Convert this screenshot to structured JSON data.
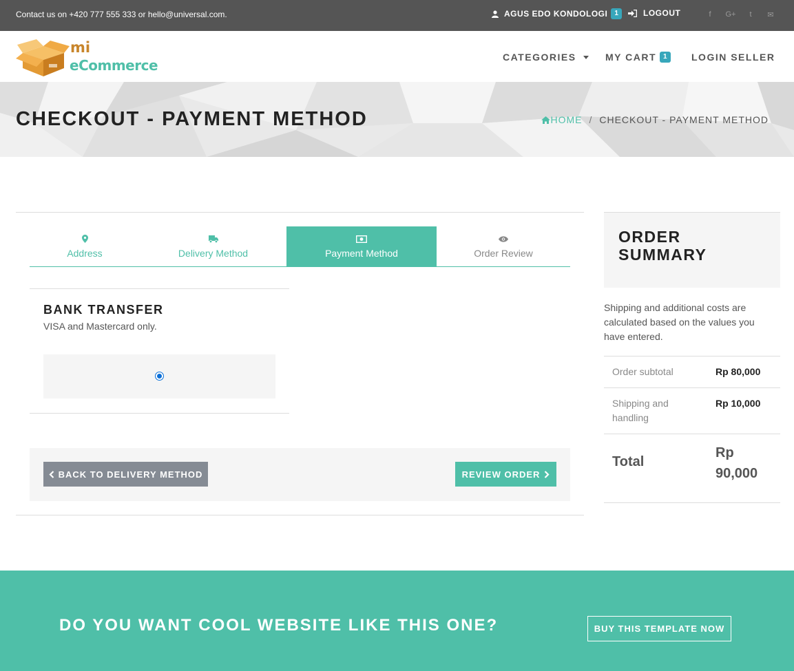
{
  "topbar": {
    "contact": "Contact us on +420 777 555 333 or hello@universal.com.",
    "user_name": "AGUS EDO KONDOLOGI",
    "user_badge": "1",
    "logout": "LOGOUT",
    "social": [
      "f",
      "G+",
      "t",
      "✉"
    ]
  },
  "nav": {
    "logo_line1": "mi",
    "logo_line2": "eCommerce",
    "categories": "CATEGORIES",
    "cart": "MY CART",
    "cart_badge": "1",
    "login_seller": "LOGIN SELLER"
  },
  "heading": {
    "title": "CHECKOUT - PAYMENT METHOD",
    "breadcrumb_home": "HOME",
    "breadcrumb_sep": "/",
    "breadcrumb_current": "CHECKOUT - PAYMENT METHOD"
  },
  "tabs": [
    {
      "label": "Address",
      "icon": "map-marker-icon"
    },
    {
      "label": "Delivery Method",
      "icon": "truck-icon"
    },
    {
      "label": "Payment Method",
      "icon": "money-icon"
    },
    {
      "label": "Order Review",
      "icon": "eye-icon"
    }
  ],
  "payment": {
    "title": "BANK TRANSFER",
    "desc": "VISA and Mastercard only.",
    "selected": true
  },
  "buttons": {
    "back": "BACK TO DELIVERY METHOD",
    "review": "REVIEW ORDER"
  },
  "summary": {
    "title": "ORDER SUMMARY",
    "text": "Shipping and additional costs are calculated based on the values you have entered.",
    "rows": [
      {
        "label": "Order subtotal",
        "value": "Rp 80,000"
      },
      {
        "label": "Shipping and handling",
        "value": "Rp 10,000"
      },
      {
        "label": "Total",
        "value": "Rp 90,000"
      }
    ]
  },
  "banner": {
    "text": "DO YOU WANT COOL WEBSITE LIKE THIS ONE?",
    "button": "BUY THIS TEMPLATE NOW"
  },
  "colors": {
    "accent": "#4fbfa8",
    "topbar": "#555555",
    "badge": "#38a7bb",
    "back_button": "#858b94"
  }
}
